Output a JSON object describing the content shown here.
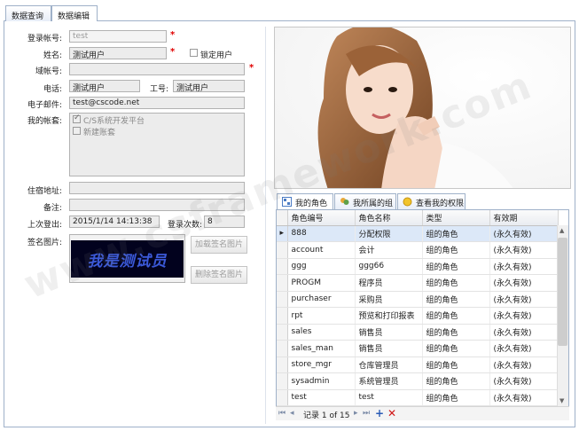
{
  "tabs": [
    {
      "label": "数据查询"
    },
    {
      "label": "数据编辑"
    }
  ],
  "form": {
    "login_label": "登录帐号:",
    "login_value": "test",
    "name_label": "姓名:",
    "name_value": "测试用户",
    "lock_label": "锁定用户",
    "domain_label": "域帐号:",
    "domain_value": "",
    "phone_label": "电话:",
    "phone_value": "测试用户",
    "empno_label": "工号:",
    "empno_value": "测试用户",
    "email_label": "电子邮件:",
    "email_value": "test@cscode.net",
    "accounts_label": "我的帐套:",
    "accounts": [
      {
        "label": "C/S系统开发平台",
        "checked": true
      },
      {
        "label": "新建账套",
        "checked": false
      }
    ],
    "address_label": "住宿地址:",
    "address_value": "",
    "remark_label": "备注:",
    "remark_value": "",
    "lastlogout_label": "上次登出:",
    "lastlogout_value": "2015/1/14 14:13:38",
    "logincount_label": "登录次数:",
    "logincount_value": "8",
    "signature_label": "签名图片:",
    "signature_text": "我是测试员",
    "load_sig_btn": "加载签名图片",
    "delete_sig_btn": "删除签名图片"
  },
  "right_tabs": [
    {
      "label": "我的角色"
    },
    {
      "label": "我所属的组"
    },
    {
      "label": "查看我的权限"
    }
  ],
  "grid": {
    "columns": [
      "角色编号",
      "角色名称",
      "类型",
      "有效期"
    ],
    "rows": [
      [
        "888",
        "分配权限",
        "组的角色",
        "(永久有效)"
      ],
      [
        "account",
        "会计",
        "组的角色",
        "(永久有效)"
      ],
      [
        "ggg",
        "ggg66",
        "组的角色",
        "(永久有效)"
      ],
      [
        "PROGM",
        "程序员",
        "组的角色",
        "(永久有效)"
      ],
      [
        "purchaser",
        "采购员",
        "组的角色",
        "(永久有效)"
      ],
      [
        "rpt",
        "预览和打印报表",
        "组的角色",
        "(永久有效)"
      ],
      [
        "sales",
        "销售员",
        "组的角色",
        "(永久有效)"
      ],
      [
        "sales_man",
        "销售员",
        "组的角色",
        "(永久有效)"
      ],
      [
        "store_mgr",
        "仓库管理员",
        "组的角色",
        "(永久有效)"
      ],
      [
        "sysadmin",
        "系统管理员",
        "组的角色",
        "(永久有效)"
      ],
      [
        "test",
        "test",
        "组的角色",
        "(永久有效)"
      ]
    ],
    "nav_text": "记录 1 of 15"
  },
  "watermark": "www.csframework.com"
}
